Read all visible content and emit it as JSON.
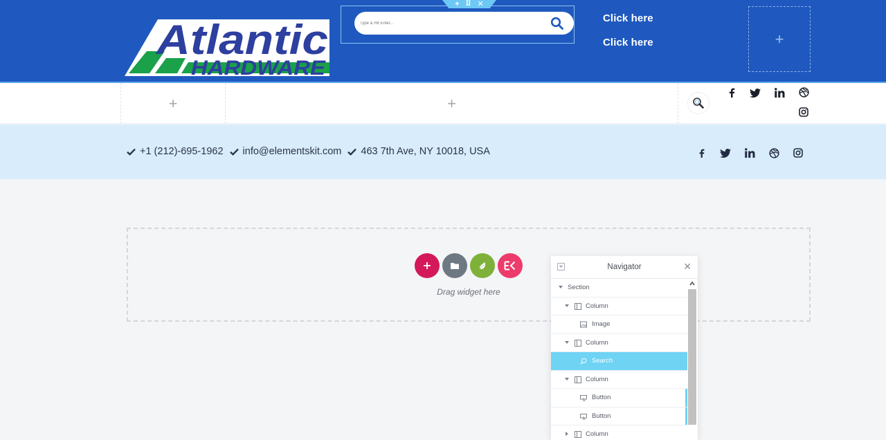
{
  "colors": {
    "header_bg": "#1f59bf",
    "info_bar_bg": "#d8ecfc",
    "navigator_active": "#6fd3f4",
    "tool_add": "#d3195a",
    "tool_folder": "#6d7882",
    "tool_leaf": "#7fb13a",
    "tool_elementskit": "#ed3b6c"
  },
  "header": {
    "logo": {
      "line1": "Atlantic",
      "line2": "HARDWARE"
    },
    "search": {
      "placeholder": "Type & Hit Enter..."
    },
    "links": [
      "Click here",
      "Click here"
    ],
    "section_handle_icons": [
      "plus-icon",
      "drag-handle-icon",
      "close-icon"
    ]
  },
  "row2": {
    "social_icons": [
      "facebook-icon",
      "twitter-icon",
      "linkedin-icon",
      "dribbble-icon",
      "instagram-icon"
    ]
  },
  "info_bar": {
    "contacts": [
      {
        "icon": "check-icon",
        "text": "+1 (212)-695-1962"
      },
      {
        "icon": "check-icon",
        "text": "info@elementskit.com"
      },
      {
        "icon": "check-icon",
        "text": "463 7th Ave, NY 10018, USA"
      }
    ],
    "social_icons": [
      "facebook-icon",
      "twitter-icon",
      "linkedin-icon",
      "dribbble-icon",
      "instagram-icon"
    ]
  },
  "dropzone": {
    "hint": "Drag widget here",
    "tools": [
      "add-section",
      "add-template",
      "envato-elements",
      "elementskit"
    ]
  },
  "navigator": {
    "title": "Navigator",
    "items": [
      {
        "label": "Section",
        "level": 0,
        "type": "section",
        "expanded": true
      },
      {
        "label": "Column",
        "level": 1,
        "type": "column",
        "expanded": true
      },
      {
        "label": "Image",
        "level": 2,
        "type": "image"
      },
      {
        "label": "Column",
        "level": 1,
        "type": "column",
        "expanded": true
      },
      {
        "label": "Search",
        "level": 2,
        "type": "search",
        "active": true
      },
      {
        "label": "Column",
        "level": 1,
        "type": "column",
        "expanded": true
      },
      {
        "label": "Button",
        "level": 2,
        "type": "button"
      },
      {
        "label": "Button",
        "level": 2,
        "type": "button"
      },
      {
        "label": "Column",
        "level": 1,
        "type": "column",
        "expanded": false
      }
    ]
  }
}
